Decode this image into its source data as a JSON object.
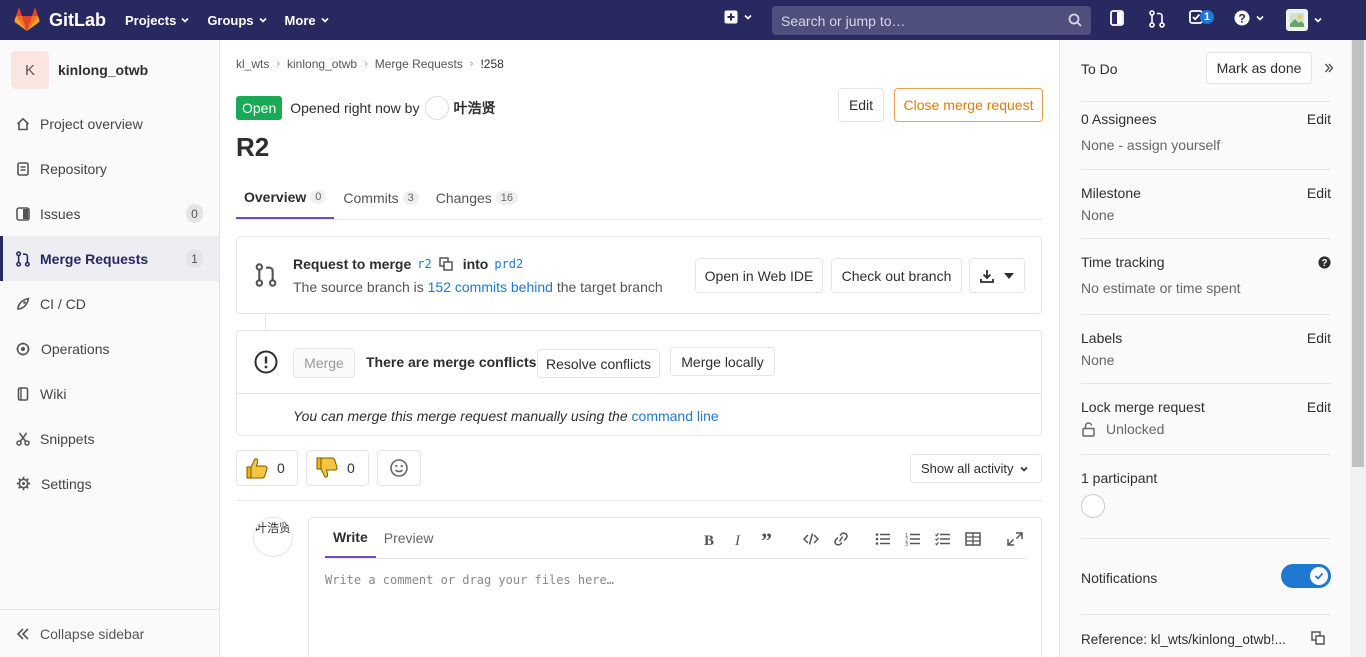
{
  "navbar": {
    "brand": "GitLab",
    "menu": [
      "Projects",
      "Groups",
      "More"
    ],
    "search_placeholder": "Search or jump to…",
    "todo_count": "1"
  },
  "sidebar": {
    "project_initial": "K",
    "project_name": "kinlong_otwb",
    "items": [
      {
        "label": "Project overview",
        "icon": "home-icon"
      },
      {
        "label": "Repository",
        "icon": "doc-icon"
      },
      {
        "label": "Issues",
        "icon": "issues-icon",
        "count": "0"
      },
      {
        "label": "Merge Requests",
        "icon": "merge-request-icon",
        "count": "1",
        "active": true
      },
      {
        "label": "CI / CD",
        "icon": "rocket-icon"
      },
      {
        "label": "Operations",
        "icon": "cloud-gear-icon"
      },
      {
        "label": "Wiki",
        "icon": "book-icon"
      },
      {
        "label": "Snippets",
        "icon": "scissors-icon"
      },
      {
        "label": "Settings",
        "icon": "gear-icon"
      }
    ],
    "collapse_label": "Collapse sidebar"
  },
  "breadcrumb": [
    "kl_wts",
    "kinlong_otwb",
    "Merge Requests",
    "!258"
  ],
  "mr": {
    "status": "Open",
    "opened_text": "Opened right now by",
    "author": "叶浩贤",
    "edit_label": "Edit",
    "close_label": "Close merge request",
    "title": "R2",
    "tabs": [
      {
        "label": "Overview",
        "count": "0"
      },
      {
        "label": "Commits",
        "count": "3"
      },
      {
        "label": "Changes",
        "count": "16"
      }
    ]
  },
  "merge_info": {
    "request_label": "Request to merge",
    "source_branch": "r2",
    "into_label": "into",
    "target_branch": "prd2",
    "behind_prefix": "The source branch is",
    "behind_link": "152 commits behind",
    "behind_suffix": "the target branch",
    "web_ide_label": "Open in Web IDE",
    "checkout_label": "Check out branch"
  },
  "conflict": {
    "merge_label": "Merge",
    "message": "There are merge conflicts",
    "resolve_label": "Resolve conflicts",
    "merge_locally_label": "Merge locally",
    "manual_text": "You can merge this merge request manually using the",
    "command_line": "command line"
  },
  "awards": {
    "thumbs_up": "0",
    "thumbs_down": "0",
    "activity_filter": "Show all activity"
  },
  "comment": {
    "avatar_alt": "叶浩贤",
    "write_tab": "Write",
    "preview_tab": "Preview",
    "placeholder": "Write a comment or drag your files here…"
  },
  "right_sidebar": {
    "todo_label": "To Do",
    "mark_done_label": "Mark as done",
    "assignees_title": "0 Assignees",
    "assignees_value": "None -",
    "assign_yourself": "assign yourself",
    "milestone_title": "Milestone",
    "milestone_value": "None",
    "time_tracking_title": "Time tracking",
    "time_tracking_value": "No estimate or time spent",
    "labels_title": "Labels",
    "labels_value": "None",
    "lock_title": "Lock merge request",
    "lock_value": "Unlocked",
    "participants_title": "1 participant",
    "notifications_title": "Notifications",
    "reference": "Reference: kl_wts/kinlong_otwb!...",
    "edit_label": "Edit"
  }
}
